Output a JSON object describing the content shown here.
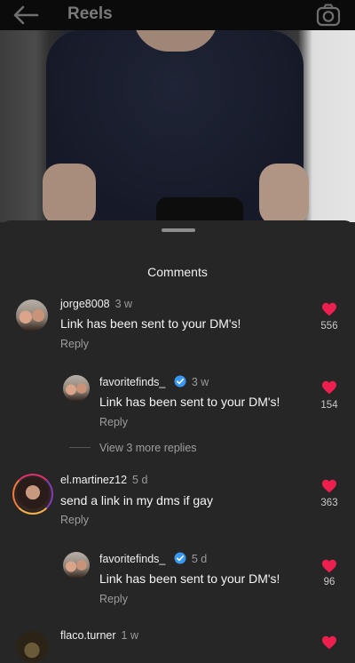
{
  "header": {
    "title": "Reels",
    "back_icon": "arrow-left-icon",
    "camera_icon": "camera-icon"
  },
  "sheet": {
    "title": "Comments"
  },
  "colors": {
    "heart": "#ed1f4f",
    "verified": "#3897f0",
    "background": "#262626"
  },
  "comments": [
    {
      "username": "jorge8008",
      "time": "3 w",
      "text": "Link has been sent to your DM's!",
      "reply_label": "Reply",
      "likes": "556"
    },
    {
      "username": "favoritefinds_",
      "time": "3 w",
      "text": "Link has been sent to your DM's!",
      "reply_label": "Reply",
      "likes": "154"
    },
    {
      "more_replies": "View 3 more replies"
    },
    {
      "username": "el.martinez12",
      "time": "5 d",
      "text": "send a link in my dms if gay",
      "reply_label": "Reply",
      "likes": "363"
    },
    {
      "username": "favoritefinds_",
      "time": "5 d",
      "text": "Link has been sent to your DM's!",
      "reply_label": "Reply",
      "likes": "96"
    },
    {
      "username": "flaco.turner",
      "time": "1 w"
    }
  ]
}
